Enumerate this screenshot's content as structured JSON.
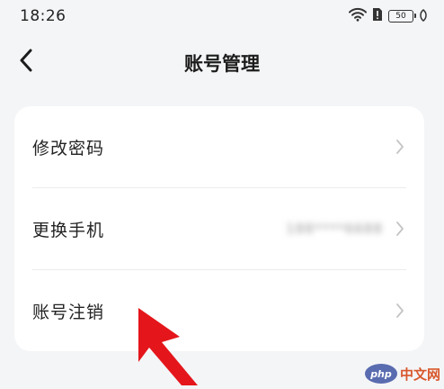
{
  "status_bar": {
    "time": "18:26",
    "battery": "50"
  },
  "header": {
    "title": "账号管理"
  },
  "settings": {
    "items": [
      {
        "label": "修改密码",
        "value": ""
      },
      {
        "label": "更换手机",
        "value": "188****6688"
      },
      {
        "label": "账号注销",
        "value": ""
      }
    ]
  },
  "watermark": {
    "logo_text": "php",
    "site_text": "中文网"
  },
  "colors": {
    "background": "#f4f5f7",
    "card": "#ffffff",
    "annotation_arrow": "#e4161b"
  }
}
